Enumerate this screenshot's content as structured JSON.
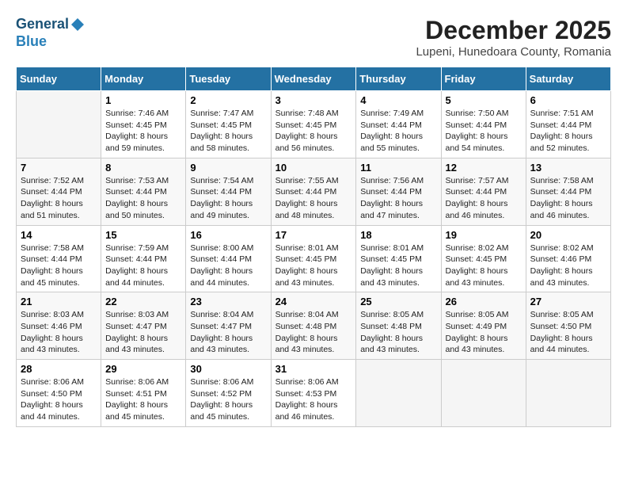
{
  "header": {
    "logo_general": "General",
    "logo_blue": "Blue",
    "month_title": "December 2025",
    "location": "Lupeni, Hunedoara County, Romania"
  },
  "days_of_week": [
    "Sunday",
    "Monday",
    "Tuesday",
    "Wednesday",
    "Thursday",
    "Friday",
    "Saturday"
  ],
  "weeks": [
    [
      {
        "day": "",
        "sunrise": "",
        "sunset": "",
        "daylight": ""
      },
      {
        "day": "1",
        "sunrise": "Sunrise: 7:46 AM",
        "sunset": "Sunset: 4:45 PM",
        "daylight": "Daylight: 8 hours and 59 minutes."
      },
      {
        "day": "2",
        "sunrise": "Sunrise: 7:47 AM",
        "sunset": "Sunset: 4:45 PM",
        "daylight": "Daylight: 8 hours and 58 minutes."
      },
      {
        "day": "3",
        "sunrise": "Sunrise: 7:48 AM",
        "sunset": "Sunset: 4:45 PM",
        "daylight": "Daylight: 8 hours and 56 minutes."
      },
      {
        "day": "4",
        "sunrise": "Sunrise: 7:49 AM",
        "sunset": "Sunset: 4:44 PM",
        "daylight": "Daylight: 8 hours and 55 minutes."
      },
      {
        "day": "5",
        "sunrise": "Sunrise: 7:50 AM",
        "sunset": "Sunset: 4:44 PM",
        "daylight": "Daylight: 8 hours and 54 minutes."
      },
      {
        "day": "6",
        "sunrise": "Sunrise: 7:51 AM",
        "sunset": "Sunset: 4:44 PM",
        "daylight": "Daylight: 8 hours and 52 minutes."
      }
    ],
    [
      {
        "day": "7",
        "sunrise": "Sunrise: 7:52 AM",
        "sunset": "Sunset: 4:44 PM",
        "daylight": "Daylight: 8 hours and 51 minutes."
      },
      {
        "day": "8",
        "sunrise": "Sunrise: 7:53 AM",
        "sunset": "Sunset: 4:44 PM",
        "daylight": "Daylight: 8 hours and 50 minutes."
      },
      {
        "day": "9",
        "sunrise": "Sunrise: 7:54 AM",
        "sunset": "Sunset: 4:44 PM",
        "daylight": "Daylight: 8 hours and 49 minutes."
      },
      {
        "day": "10",
        "sunrise": "Sunrise: 7:55 AM",
        "sunset": "Sunset: 4:44 PM",
        "daylight": "Daylight: 8 hours and 48 minutes."
      },
      {
        "day": "11",
        "sunrise": "Sunrise: 7:56 AM",
        "sunset": "Sunset: 4:44 PM",
        "daylight": "Daylight: 8 hours and 47 minutes."
      },
      {
        "day": "12",
        "sunrise": "Sunrise: 7:57 AM",
        "sunset": "Sunset: 4:44 PM",
        "daylight": "Daylight: 8 hours and 46 minutes."
      },
      {
        "day": "13",
        "sunrise": "Sunrise: 7:58 AM",
        "sunset": "Sunset: 4:44 PM",
        "daylight": "Daylight: 8 hours and 46 minutes."
      }
    ],
    [
      {
        "day": "14",
        "sunrise": "Sunrise: 7:58 AM",
        "sunset": "Sunset: 4:44 PM",
        "daylight": "Daylight: 8 hours and 45 minutes."
      },
      {
        "day": "15",
        "sunrise": "Sunrise: 7:59 AM",
        "sunset": "Sunset: 4:44 PM",
        "daylight": "Daylight: 8 hours and 44 minutes."
      },
      {
        "day": "16",
        "sunrise": "Sunrise: 8:00 AM",
        "sunset": "Sunset: 4:44 PM",
        "daylight": "Daylight: 8 hours and 44 minutes."
      },
      {
        "day": "17",
        "sunrise": "Sunrise: 8:01 AM",
        "sunset": "Sunset: 4:45 PM",
        "daylight": "Daylight: 8 hours and 43 minutes."
      },
      {
        "day": "18",
        "sunrise": "Sunrise: 8:01 AM",
        "sunset": "Sunset: 4:45 PM",
        "daylight": "Daylight: 8 hours and 43 minutes."
      },
      {
        "day": "19",
        "sunrise": "Sunrise: 8:02 AM",
        "sunset": "Sunset: 4:45 PM",
        "daylight": "Daylight: 8 hours and 43 minutes."
      },
      {
        "day": "20",
        "sunrise": "Sunrise: 8:02 AM",
        "sunset": "Sunset: 4:46 PM",
        "daylight": "Daylight: 8 hours and 43 minutes."
      }
    ],
    [
      {
        "day": "21",
        "sunrise": "Sunrise: 8:03 AM",
        "sunset": "Sunset: 4:46 PM",
        "daylight": "Daylight: 8 hours and 43 minutes."
      },
      {
        "day": "22",
        "sunrise": "Sunrise: 8:03 AM",
        "sunset": "Sunset: 4:47 PM",
        "daylight": "Daylight: 8 hours and 43 minutes."
      },
      {
        "day": "23",
        "sunrise": "Sunrise: 8:04 AM",
        "sunset": "Sunset: 4:47 PM",
        "daylight": "Daylight: 8 hours and 43 minutes."
      },
      {
        "day": "24",
        "sunrise": "Sunrise: 8:04 AM",
        "sunset": "Sunset: 4:48 PM",
        "daylight": "Daylight: 8 hours and 43 minutes."
      },
      {
        "day": "25",
        "sunrise": "Sunrise: 8:05 AM",
        "sunset": "Sunset: 4:48 PM",
        "daylight": "Daylight: 8 hours and 43 minutes."
      },
      {
        "day": "26",
        "sunrise": "Sunrise: 8:05 AM",
        "sunset": "Sunset: 4:49 PM",
        "daylight": "Daylight: 8 hours and 43 minutes."
      },
      {
        "day": "27",
        "sunrise": "Sunrise: 8:05 AM",
        "sunset": "Sunset: 4:50 PM",
        "daylight": "Daylight: 8 hours and 44 minutes."
      }
    ],
    [
      {
        "day": "28",
        "sunrise": "Sunrise: 8:06 AM",
        "sunset": "Sunset: 4:50 PM",
        "daylight": "Daylight: 8 hours and 44 minutes."
      },
      {
        "day": "29",
        "sunrise": "Sunrise: 8:06 AM",
        "sunset": "Sunset: 4:51 PM",
        "daylight": "Daylight: 8 hours and 45 minutes."
      },
      {
        "day": "30",
        "sunrise": "Sunrise: 8:06 AM",
        "sunset": "Sunset: 4:52 PM",
        "daylight": "Daylight: 8 hours and 45 minutes."
      },
      {
        "day": "31",
        "sunrise": "Sunrise: 8:06 AM",
        "sunset": "Sunset: 4:53 PM",
        "daylight": "Daylight: 8 hours and 46 minutes."
      },
      {
        "day": "",
        "sunrise": "",
        "sunset": "",
        "daylight": ""
      },
      {
        "day": "",
        "sunrise": "",
        "sunset": "",
        "daylight": ""
      },
      {
        "day": "",
        "sunrise": "",
        "sunset": "",
        "daylight": ""
      }
    ]
  ]
}
